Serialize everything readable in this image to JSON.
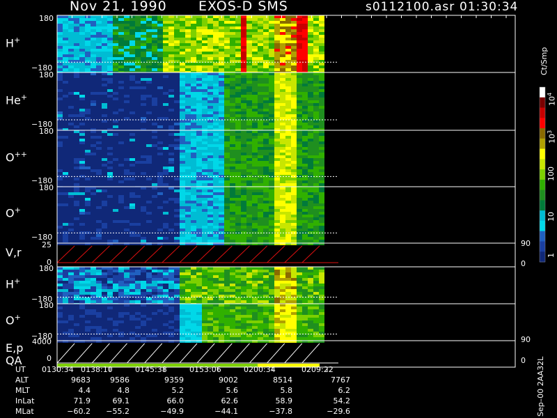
{
  "header": {
    "date": "Nov 21, 1990",
    "instrument": "EXOS-D SMS",
    "file": "s0112100.asr",
    "time": "01:30:34"
  },
  "panels": [
    {
      "species": "H",
      "charge": "+",
      "top": "180",
      "bottom": "−180"
    },
    {
      "species": "He",
      "charge": "+",
      "top": "180",
      "bottom": "−180"
    },
    {
      "species": "O",
      "charge": "++",
      "top": "180",
      "bottom": "−180"
    },
    {
      "species": "O",
      "charge": "+",
      "top": "180",
      "bottom": "−180"
    },
    {
      "species": "V,r",
      "charge": "",
      "top": "25",
      "bottom": "0",
      "right_top": "90",
      "right_bottom": "0"
    },
    {
      "species": "H",
      "charge": "+",
      "top": "180",
      "bottom": "−180"
    },
    {
      "species": "O",
      "charge": "+",
      "top": "180",
      "bottom": "−180"
    },
    {
      "species": "E,p",
      "species2": "QA",
      "charge": "",
      "top": "4000",
      "bottom": "0",
      "right_top": "90",
      "right_bottom": "0"
    }
  ],
  "colorbar": {
    "unit": "Ct/Smp",
    "ticks": [
      "10",
      "10",
      "10",
      "100",
      "10",
      "1"
    ],
    "exponents": [
      "4",
      "3",
      "",
      "",
      "",
      ""
    ],
    "colors": [
      "#ffffff",
      "#7a0000",
      "#c80000",
      "#ff0000",
      "#8a6a00",
      "#b0a000",
      "#ffff00",
      "#c8e600",
      "#7dd000",
      "#30b000",
      "#1f8f1f",
      "#007a3a",
      "#00bcd4",
      "#00d8e8",
      "#2060c0",
      "#1a3fa0",
      "#102878"
    ]
  },
  "side_label": "Sep–00  2AA32L",
  "table": {
    "rows": [
      {
        "label": "UT",
        "values": [
          "0130:34",
          "0138:10",
          "0145:38",
          "0153:06",
          "0200:34",
          "0209:22"
        ]
      },
      {
        "label": "ALT",
        "values": [
          "9683",
          "9586",
          "9359",
          "9002",
          "8514",
          "7767"
        ]
      },
      {
        "label": "MLT",
        "values": [
          "4.4",
          "4.8",
          "5.2",
          "5.6",
          "5.8",
          "6.2"
        ]
      },
      {
        "label": "InLat",
        "values": [
          "71.9",
          "69.1",
          "66.0",
          "62.6",
          "58.9",
          "54.2"
        ]
      },
      {
        "label": "MLat",
        "values": [
          "−60.2",
          "−55.2",
          "−49.9",
          "−44.1",
          "−37.8",
          "−29.6"
        ]
      }
    ]
  },
  "chart_data": {
    "type": "heatmap",
    "title": "Nov 21, 1990   EXOS-D SMS",
    "x_ticks": [
      "0130:34",
      "0138:10",
      "0145:38",
      "0153:06",
      "0200:34",
      "0209:22"
    ],
    "colorbar_unit": "Ct/Smp",
    "colorbar_range": [
      1,
      10000
    ],
    "colorbar_scale": "log",
    "panels": [
      {
        "label": "H+",
        "ylim": [
          -180,
          180
        ]
      },
      {
        "label": "He+",
        "ylim": [
          -180,
          180
        ]
      },
      {
        "label": "O++",
        "ylim": [
          -180,
          180
        ]
      },
      {
        "label": "O+",
        "ylim": [
          -180,
          180
        ]
      },
      {
        "label": "V,r",
        "ylim": [
          0,
          25
        ],
        "y2lim": [
          0,
          90
        ]
      },
      {
        "label": "H+",
        "ylim": [
          -180,
          180
        ]
      },
      {
        "label": "O+",
        "ylim": [
          -180,
          180
        ]
      },
      {
        "label": "E,p QA",
        "ylim": [
          0,
          4000
        ],
        "y2lim": [
          0,
          90
        ]
      }
    ]
  }
}
